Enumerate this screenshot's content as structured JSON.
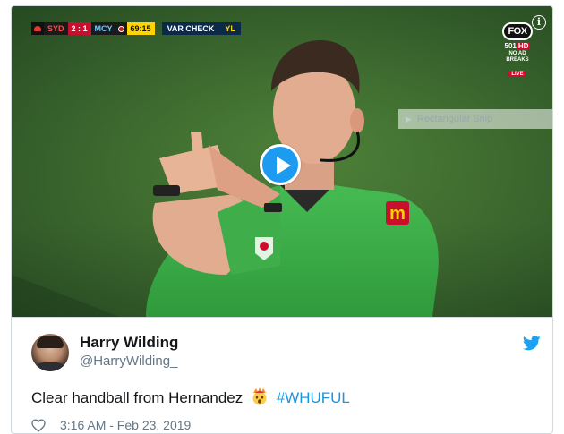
{
  "video": {
    "scorebar": {
      "home_team": "SYD",
      "score": "2 : 1",
      "away_team": "MCY",
      "match_time": "69:15",
      "overlay_label": "VAR CHECK",
      "overlay_tag": "YL"
    },
    "broadcaster": {
      "logo_text": "FOX",
      "channel": "501",
      "channel_tag": "HD",
      "no_ad_line1": "NO AD",
      "no_ad_line2": "BREAKS",
      "live": "LIVE"
    },
    "ghost_label": "Rectangular Snip",
    "info_glyph": "i",
    "play_icon": "play-icon"
  },
  "tweet": {
    "author_name": "Harry Wilding",
    "author_handle": "@HarryWilding_",
    "text": "Clear handball from Hernandez",
    "emoji": "exploding-head-emoji",
    "hashtag": "#WHUFUL",
    "timestamp": "3:16 AM - Feb 23, 2019",
    "like_icon": "heart-icon",
    "brand_icon": "twitter-bird-icon"
  },
  "colors": {
    "twitter_blue": "#1d9bf0",
    "hashtag_blue": "#1b95e0",
    "meta_gray": "#657786",
    "text_dark": "#14171a",
    "referee_shirt": "#3fae4a"
  }
}
